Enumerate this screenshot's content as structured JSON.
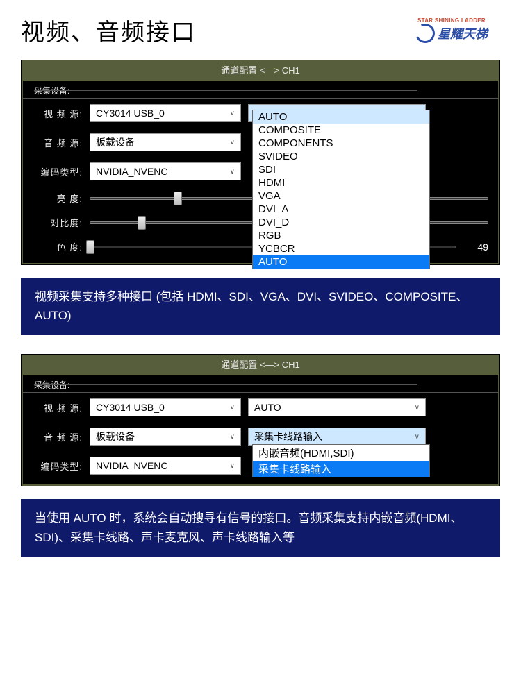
{
  "page_title": "视频、音频接口",
  "logo": {
    "english": "STAR SHINING LADDER",
    "chinese": "星耀天梯"
  },
  "panel1": {
    "title": "通道配置 <—> CH1",
    "group_label": "采集设备:",
    "labels": {
      "video_src": "视 频 源:",
      "audio_src": "音 频 源:",
      "encoding": "编码类型:",
      "brightness": "亮  度:",
      "contrast": "对比度:",
      "hue": "色  度:"
    },
    "values": {
      "video_src": "CY3014 USB_0",
      "audio_src": "板载设备",
      "encoding": "NVIDIA_NVENC",
      "video_mode": "AUTO",
      "hue_value": "49"
    },
    "video_mode_options": [
      "COMPOSITE",
      "COMPONENTS",
      "SVIDEO",
      "SDI",
      "HDMI",
      "VGA",
      "DVI_A",
      "DVI_D",
      "RGB",
      "YCBCR",
      "AUTO"
    ]
  },
  "desc1": "视频采集支持多种接口 (包括 HDMI、SDI、VGA、DVI、SVIDEO、COMPOSITE、AUTO)",
  "panel2": {
    "title": "通道配置 <—> CH1",
    "group_label": "采集设备:",
    "labels": {
      "video_src": "视 频 源:",
      "audio_src": "音 频 源:",
      "encoding": "编码类型:"
    },
    "values": {
      "video_src": "CY3014 USB_0",
      "video_mode": "AUTO",
      "audio_src": "板载设备",
      "audio_mode": "采集卡线路输入",
      "encoding": "NVIDIA_NVENC"
    },
    "audio_mode_options": [
      "内嵌音频(HDMI,SDI)",
      "采集卡线路输入"
    ]
  },
  "desc2": "当使用 AUTO 时，系统会自动搜寻有信号的接口。音频采集支持内嵌音频(HDMI、SDI)、采集卡线路、声卡麦克风、声卡线路输入等"
}
